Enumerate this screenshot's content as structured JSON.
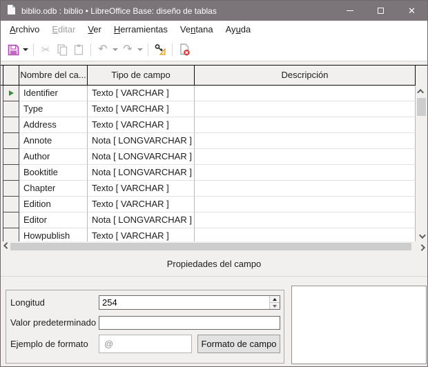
{
  "window": {
    "title": "biblio.odb : biblio • LibreOffice Base: diseño de tablas",
    "controls": [
      "minimize",
      "maximize",
      "close"
    ]
  },
  "menubar": {
    "items": [
      {
        "label": "Archivo",
        "key": "A",
        "enabled": true
      },
      {
        "label": "Editar",
        "key": "E",
        "enabled": false
      },
      {
        "label": "Ver",
        "key": "V",
        "enabled": true
      },
      {
        "label": "Herramientas",
        "key": "H",
        "enabled": true
      },
      {
        "label": "Ventana",
        "key": "n",
        "enabled": true
      },
      {
        "label": "Ayuda",
        "key": "u",
        "enabled": true
      }
    ]
  },
  "toolbar": {
    "icons": [
      "save",
      "save-dropdown",
      "cut",
      "copy",
      "paste",
      "undo",
      "undo-dropdown",
      "redo",
      "redo-dropdown",
      "index-design",
      "delete-row"
    ]
  },
  "grid": {
    "columns": [
      "Nombre del ca...",
      "Tipo de campo",
      "Descripción"
    ],
    "rows": [
      {
        "name": "Identifier",
        "type": "Texto [ VARCHAR ]",
        "description": "",
        "current": true
      },
      {
        "name": "Type",
        "type": "Texto [ VARCHAR ]",
        "description": "",
        "current": false
      },
      {
        "name": "Address",
        "type": "Texto [ VARCHAR ]",
        "description": "",
        "current": false
      },
      {
        "name": "Annote",
        "type": "Nota [ LONGVARCHAR ]",
        "description": "",
        "current": false
      },
      {
        "name": "Author",
        "type": "Nota [ LONGVARCHAR ]",
        "description": "",
        "current": false
      },
      {
        "name": "Booktitle",
        "type": "Nota [ LONGVARCHAR ]",
        "description": "",
        "current": false
      },
      {
        "name": "Chapter",
        "type": "Texto [ VARCHAR ]",
        "description": "",
        "current": false
      },
      {
        "name": "Edition",
        "type": "Texto [ VARCHAR ]",
        "description": "",
        "current": false
      },
      {
        "name": "Editor",
        "type": "Nota [ LONGVARCHAR ]",
        "description": "",
        "current": false
      },
      {
        "name": "Howpublish",
        "type": "Texto [ VARCHAR ]",
        "description": "",
        "current": false
      }
    ]
  },
  "properties": {
    "section_label": "Propiedades del campo",
    "longitud": {
      "label": "Longitud",
      "value": "254"
    },
    "valor_predeterminado": {
      "label": "Valor predeterminado",
      "value": ""
    },
    "ejemplo_formato": {
      "label": "Ejemplo de formato",
      "value": "@",
      "button_label": "Formato de campo"
    }
  },
  "colors": {
    "titlebar": "#7b7579",
    "accent_magenta": "#b04ab0",
    "marker_green": "#3d8b3d",
    "panel_gray": "#f1f0ef",
    "delete_red": "#d84040",
    "index_orange": "#f6c24a"
  }
}
